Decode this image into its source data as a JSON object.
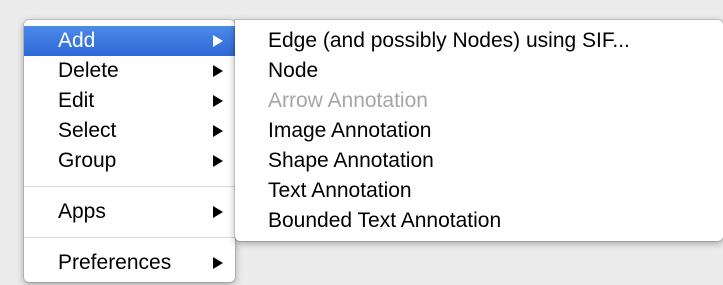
{
  "main_menu": {
    "add": "Add",
    "delete": "Delete",
    "edit": "Edit",
    "select": "Select",
    "group": "Group",
    "apps": "Apps",
    "preferences": "Preferences"
  },
  "submenu": {
    "edge_sif": "Edge (and possibly Nodes) using SIF...",
    "node": "Node",
    "arrow_annotation": "Arrow Annotation",
    "image_annotation": "Image Annotation",
    "shape_annotation": "Shape Annotation",
    "text_annotation": "Text Annotation",
    "bounded_text_annotation": "Bounded Text Annotation"
  },
  "colors": {
    "highlight": "#3875d7",
    "disabled_text": "#a6a6a6"
  }
}
